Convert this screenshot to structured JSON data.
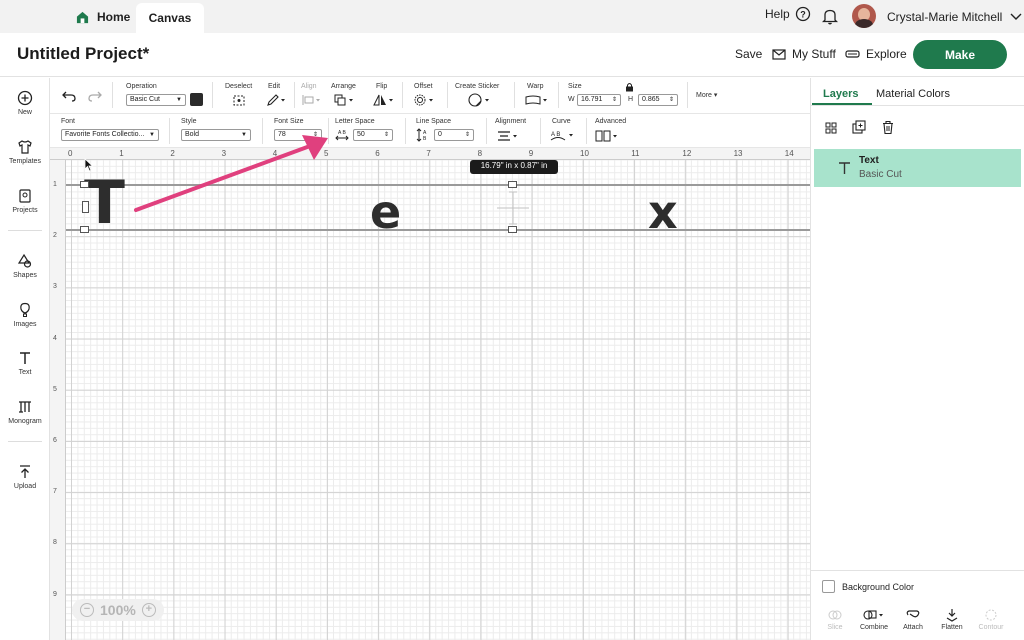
{
  "tabs": {
    "home": "Home",
    "canvas": "Canvas"
  },
  "top_right": {
    "help": "Help",
    "user_name": "Crystal-Marie Mitchell"
  },
  "title_bar": {
    "project_title": "Untitled Project*",
    "save": "Save",
    "my_stuff": "My Stuff",
    "explore": "Explore",
    "make": "Make"
  },
  "left_nav": [
    "New",
    "Templates",
    "Projects",
    "Shapes",
    "Images",
    "Text",
    "Monogram",
    "Upload"
  ],
  "toolbar1": {
    "operation_label": "Operation",
    "operation_value": "Basic Cut",
    "deselect": "Deselect",
    "edit": "Edit",
    "align": "Align",
    "arrange": "Arrange",
    "flip": "Flip",
    "offset": "Offset",
    "create_sticker": "Create Sticker",
    "warp": "Warp",
    "size": "Size",
    "w_label": "W",
    "w_value": "16.791",
    "h_label": "H",
    "h_value": "0.865",
    "more": "More"
  },
  "toolbar2": {
    "font_label": "Font",
    "font_value": "Favorite Fonts Collectio...",
    "style_label": "Style",
    "style_value": "Bold",
    "font_size_label": "Font Size",
    "font_size_value": "78",
    "letter_space_label": "Letter Space",
    "letter_space_value": "50",
    "line_space_label": "Line Space",
    "line_space_value": "0",
    "alignment_label": "Alignment",
    "curve_label": "Curve",
    "advanced_label": "Advanced"
  },
  "ruler": {
    "top": [
      "0",
      "1",
      "2",
      "3",
      "4",
      "5",
      "6",
      "7",
      "8",
      "9",
      "10",
      "11",
      "12",
      "13",
      "14"
    ],
    "left": [
      "1",
      "2",
      "3",
      "4",
      "5",
      "6",
      "7",
      "8",
      "9"
    ]
  },
  "canvas": {
    "glyphs": [
      "T",
      "e",
      "x"
    ],
    "size_tooltip": "16.79\" in x 0.87\" in",
    "zoom": "100%"
  },
  "right_panel": {
    "tab_layers": "Layers",
    "tab_material": "Material Colors",
    "layer_name": "Text",
    "layer_sub": "Basic Cut",
    "background_color": "Background Color",
    "bottom_tools": [
      "Slice",
      "Combine",
      "Attach",
      "Flatten",
      "Contour"
    ]
  },
  "colors": {
    "brand": "#1f7a4d",
    "layer_highlight": "#a8e3cc",
    "arrow": "#e0407e"
  }
}
